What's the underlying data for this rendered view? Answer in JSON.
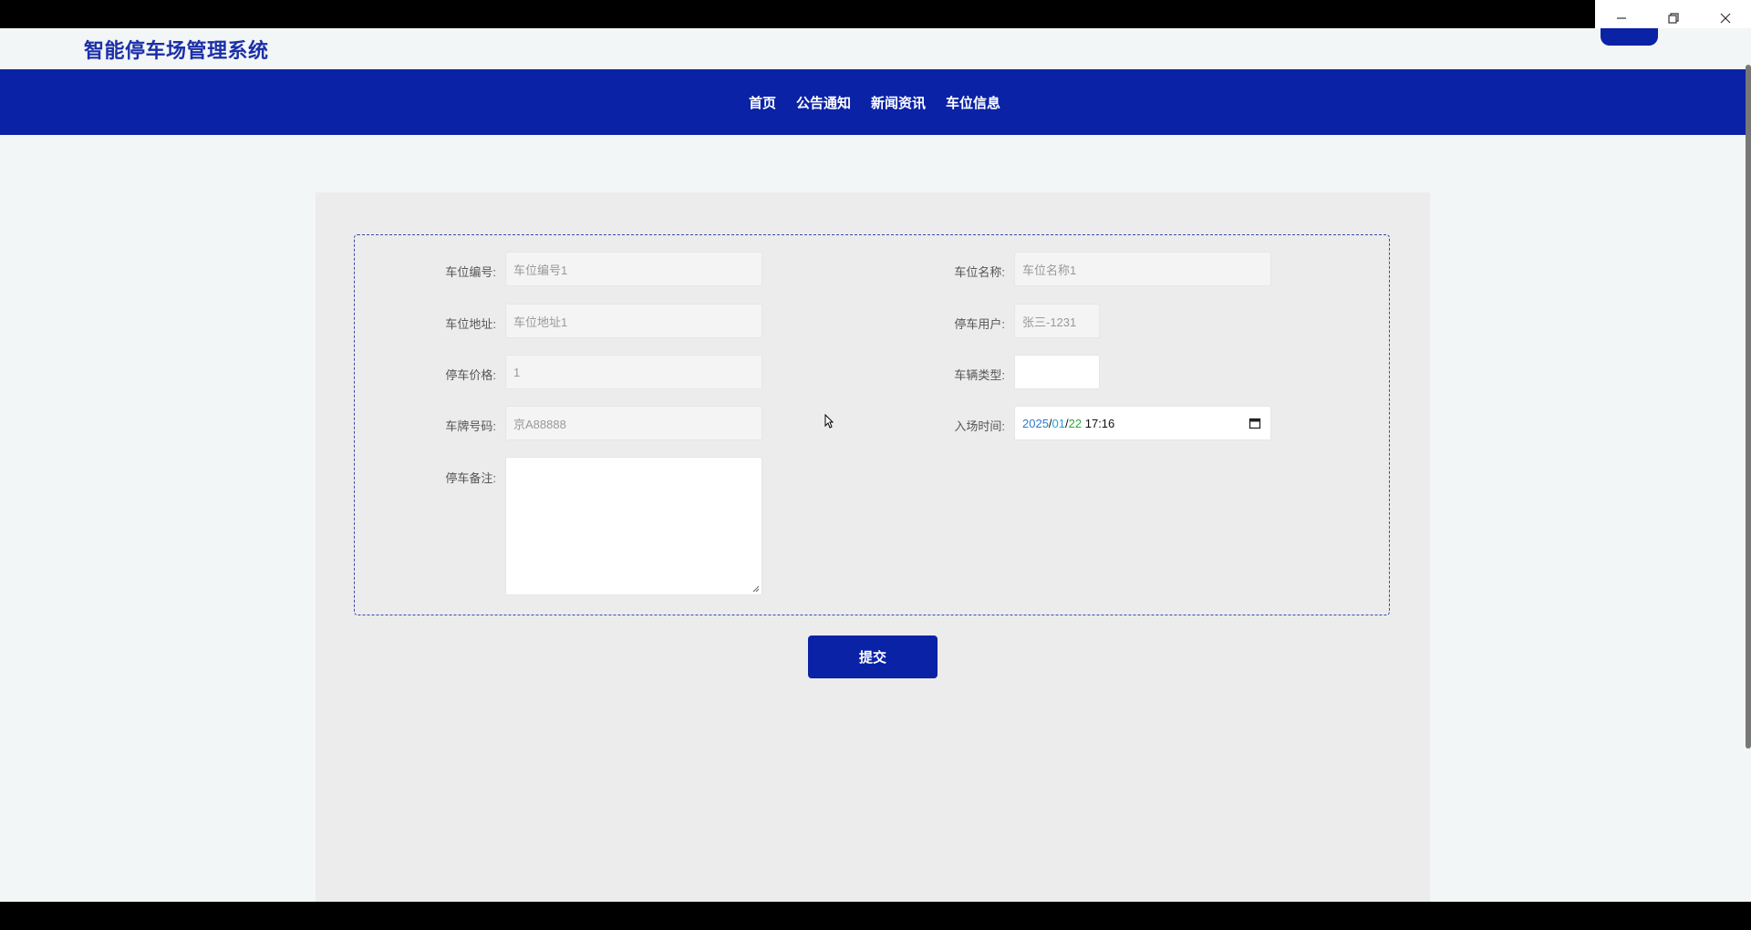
{
  "window": {
    "minimize_icon": "minimize-icon",
    "restore_icon": "restore-icon",
    "close_icon": "close-icon"
  },
  "header": {
    "site_title": "智能停车场管理系统"
  },
  "nav": {
    "items": [
      {
        "label": "首页"
      },
      {
        "label": "公告通知"
      },
      {
        "label": "新闻资讯"
      },
      {
        "label": "车位信息"
      }
    ]
  },
  "form": {
    "fields": {
      "space_no": {
        "label": "车位编号:",
        "value": "车位编号1"
      },
      "space_name": {
        "label": "车位名称:",
        "value": "车位名称1"
      },
      "space_address": {
        "label": "车位地址:",
        "value": "车位地址1"
      },
      "parking_user": {
        "label": "停车用户:",
        "value": "张三-1231"
      },
      "parking_price": {
        "label": "停车价格:",
        "value": "1"
      },
      "vehicle_type": {
        "label": "车辆类型:",
        "value": ""
      },
      "plate_no": {
        "label": "车牌号码:",
        "value": "京A88888"
      },
      "entry_time": {
        "label": "入场时间:",
        "year": "2025",
        "month": "01",
        "day": "22",
        "time": "17:16"
      },
      "remark": {
        "label": "停车备注:",
        "value": ""
      }
    },
    "submit_label": "提交"
  },
  "colors": {
    "primary": "#0a22a6",
    "title": "#1b2fa8"
  }
}
